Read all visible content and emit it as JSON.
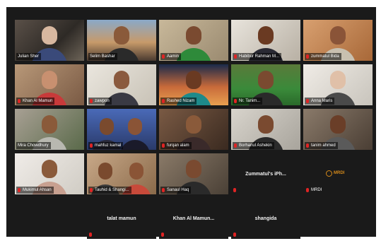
{
  "participants": [
    {
      "name": "Julian Sher",
      "muted": false
    },
    {
      "name": "Selim Bashar",
      "muted": false,
      "active_speaker": true
    },
    {
      "name": "Aamin",
      "muted": true
    },
    {
      "name": "Habibur Rahman M...",
      "muted": true
    },
    {
      "name": "zummatul Bida",
      "muted": true
    },
    {
      "name": "Khan Al Mamun",
      "muted": true
    },
    {
      "name": "zawpon",
      "muted": true
    },
    {
      "name": "Rashed Nizam",
      "muted": true
    },
    {
      "name": "Nr. Tanim...",
      "muted": true
    },
    {
      "name": "Anna Maris",
      "muted": true
    },
    {
      "name": "Mira Chowdhury",
      "muted": false
    },
    {
      "name": "mahfuz kamal",
      "muted": true
    },
    {
      "name": "furqan alam",
      "muted": true
    },
    {
      "name": "Borhanul Ashekin",
      "muted": true
    },
    {
      "name": "tanim ahmed",
      "muted": true
    },
    {
      "name": "Mukimul Ahsan",
      "muted": true
    },
    {
      "name": "Tauhid & Shangi...",
      "muted": true
    },
    {
      "name": "Sanaul Haq",
      "muted": true
    },
    {
      "name": "Zummatul's iPh...",
      "muted": true
    },
    {
      "name": "MRDI",
      "muted": true
    },
    {
      "name": "talat mamun",
      "muted": true
    },
    {
      "name": "Khan Al Mamun...",
      "muted": true
    },
    {
      "name": "shangida",
      "muted": true
    }
  ],
  "mrdi_logo_text": "MRDI",
  "colors": {
    "active_border": "#e8e34a",
    "muted_mic": "#e02424",
    "tile_empty_bg": "#1a1a1a"
  }
}
